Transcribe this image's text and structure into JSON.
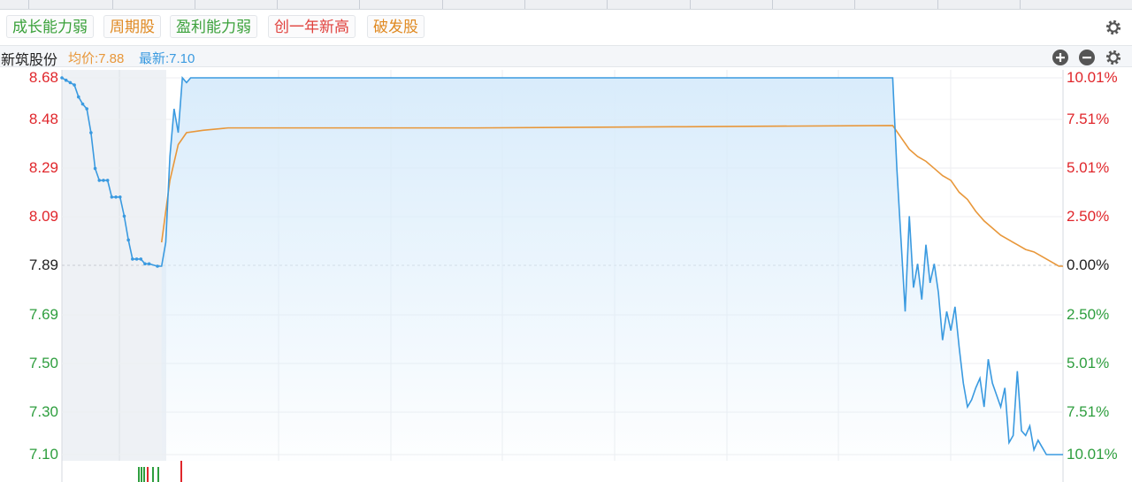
{
  "tags": [
    {
      "label": "成长能力弱",
      "color": "#3aa13a"
    },
    {
      "label": "周期股",
      "color": "#e08a22"
    },
    {
      "label": "盈利能力弱",
      "color": "#3aa13a"
    },
    {
      "label": "创一年新高",
      "color": "#e0413d"
    },
    {
      "label": "破发股",
      "color": "#e08a22"
    }
  ],
  "info": {
    "stock_name": "新筑股份",
    "avg_label": "均价:7.88",
    "latest_label": "最新:7.10"
  },
  "colors": {
    "up": "#e0262b",
    "down": "#2e9e3e",
    "neutral": "#222222",
    "price_line": "#3a9ae0",
    "avg_line": "#e8973a",
    "fill": "#d9ecfb"
  },
  "icons": {
    "settings": "gear-icon",
    "zoom_in": "plus-circle-icon",
    "zoom_out": "minus-circle-icon"
  },
  "chart_data": {
    "type": "line",
    "title": "",
    "prev_close": 7.89,
    "ylim": [
      7.1,
      8.68
    ],
    "y_ticks_left": [
      "8.68",
      "8.48",
      "8.29",
      "8.09",
      "7.89",
      "7.69",
      "7.50",
      "7.30",
      "7.10"
    ],
    "y_ticks_right": [
      "10.01%",
      "7.51%",
      "5.01%",
      "2.50%",
      "0.00%",
      "2.50%",
      "5.01%",
      "7.51%",
      "10.01%"
    ],
    "x_range": [
      0,
      241
    ],
    "series": [
      {
        "name": "",
        "role": "price",
        "x": [
          0,
          1,
          2,
          3,
          4,
          5,
          6,
          7,
          8,
          9,
          10,
          11,
          12,
          13,
          14,
          15,
          16,
          17,
          18,
          19,
          20,
          21,
          23,
          24,
          25,
          26,
          27,
          28,
          29,
          30,
          31,
          32,
          33,
          34,
          35,
          36,
          37,
          38,
          39,
          41,
          42,
          44,
          200,
          201,
          202,
          203,
          204,
          205,
          206,
          207,
          208,
          209,
          210,
          211,
          212,
          213,
          214,
          215,
          216,
          217,
          218,
          219,
          220,
          221,
          222,
          223,
          224,
          225,
          226,
          227,
          228,
          229,
          230,
          231,
          232,
          233,
          234,
          235,
          236,
          237,
          241
        ],
        "values": [
          8.68,
          8.67,
          8.66,
          8.65,
          8.6,
          8.57,
          8.55,
          8.45,
          8.3,
          8.25,
          8.25,
          8.25,
          8.18,
          8.18,
          8.18,
          8.1,
          8.0,
          7.92,
          7.92,
          7.92,
          7.9,
          7.9,
          7.89,
          7.89,
          7.99,
          8.35,
          8.55,
          8.45,
          8.68,
          8.66,
          8.68,
          8.68,
          8.68,
          8.68,
          8.68,
          8.68,
          8.68,
          8.68,
          8.68,
          8.68,
          8.68,
          8.68,
          8.68,
          8.3,
          8.0,
          7.7,
          8.1,
          7.8,
          7.9,
          7.75,
          7.98,
          7.82,
          7.9,
          7.78,
          7.58,
          7.7,
          7.62,
          7.72,
          7.55,
          7.4,
          7.3,
          7.33,
          7.38,
          7.42,
          7.3,
          7.5,
          7.4,
          7.35,
          7.3,
          7.38,
          7.15,
          7.18,
          7.45,
          7.2,
          7.18,
          7.22,
          7.12,
          7.16,
          7.13,
          7.1,
          7.1
        ]
      },
      {
        "name": "",
        "role": "average",
        "x": [
          24,
          26,
          28,
          30,
          34,
          40,
          50,
          60,
          100,
          150,
          200,
          202,
          204,
          206,
          208,
          210,
          212,
          214,
          216,
          218,
          220,
          222,
          224,
          226,
          228,
          230,
          232,
          234,
          236,
          238,
          240,
          241
        ],
        "values": [
          7.99,
          8.25,
          8.4,
          8.45,
          8.46,
          8.47,
          8.47,
          8.47,
          8.47,
          8.475,
          8.48,
          8.43,
          8.38,
          8.35,
          8.33,
          8.3,
          8.27,
          8.25,
          8.2,
          8.17,
          8.12,
          8.08,
          8.05,
          8.02,
          8.0,
          7.98,
          7.96,
          7.95,
          7.93,
          7.91,
          7.89,
          7.89
        ]
      }
    ],
    "grid": true,
    "pre_market_shaded": true
  }
}
